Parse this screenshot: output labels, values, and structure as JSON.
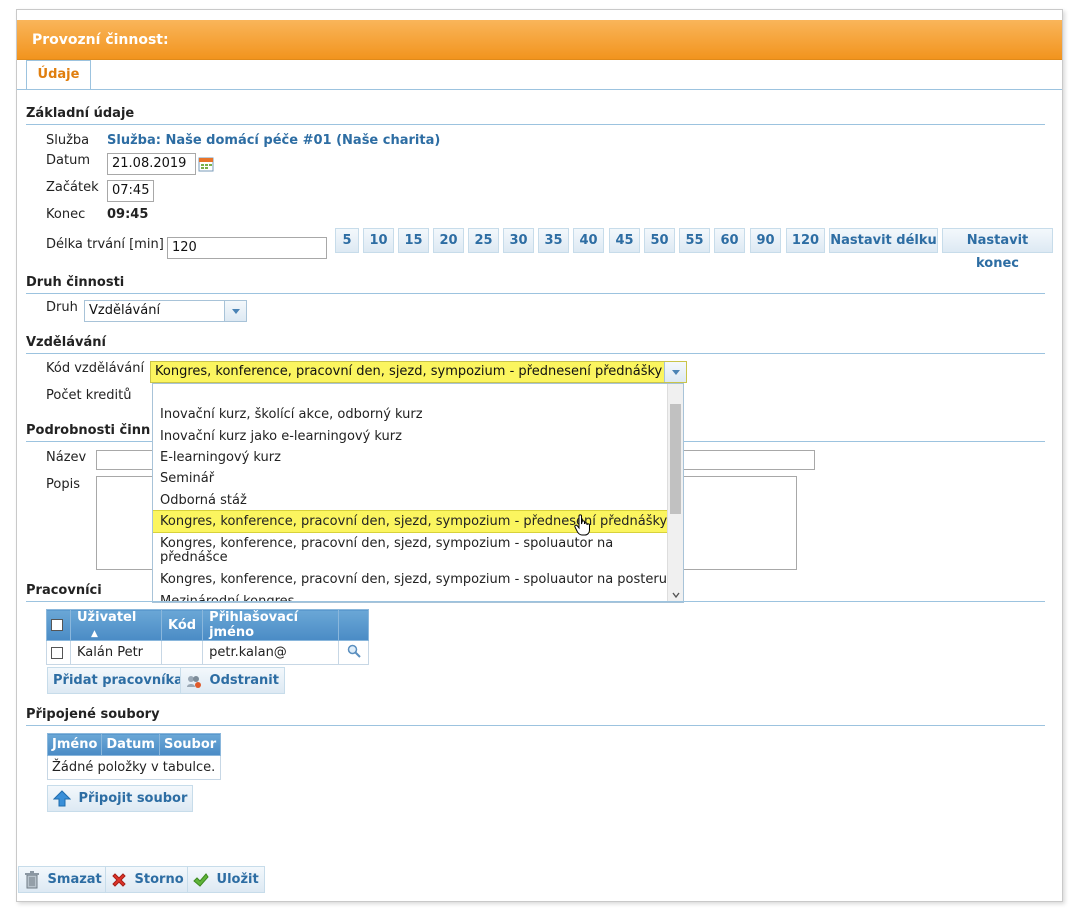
{
  "window": {
    "title": "Provozní činnost:"
  },
  "tabs": [
    {
      "label": "Údaje"
    }
  ],
  "basic": {
    "section_title": "Základní údaje",
    "service_label": "Služba",
    "service_value": "Služba: Naše domácí péče #01 (Naše charita)",
    "date_label": "Datum",
    "date_value": "21.08.2019",
    "start_label": "Začátek",
    "start_value": "07:45",
    "end_label": "Konec",
    "end_value": "09:45",
    "duration_label": "Délka trvání [min]",
    "duration_value": "120",
    "duration_buttons": [
      "5",
      "10",
      "15",
      "20",
      "25",
      "30",
      "35",
      "40",
      "45",
      "50",
      "55",
      "60",
      "90",
      "120"
    ],
    "set_duration_label": "Nastavit délku",
    "set_end_label": "Nastavit konec"
  },
  "activity": {
    "section_title": "Druh činnosti",
    "kind_label": "Druh",
    "kind_value": "Vzdělávání"
  },
  "education": {
    "section_title": "Vzdělávání",
    "code_label": "Kód vzdělávání",
    "code_value": "Kongres, konference, pracovní den, sjezd, sympozium - přednesení přednášky",
    "credits_label": "Počet kreditů",
    "options": [
      "Inovační kurz, školící akce, odborný kurz",
      "Inovační kurz jako e-learningový kurz",
      "E-learningový kurz",
      "Seminář",
      "Odborná stáž",
      "Kongres, konference, pracovní den, sjezd, sympozium - přednesení přednášky",
      "Kongres, konference, pracovní den, sjezd, sympozium - spoluautor na přednášce",
      "Kongres, konference, pracovní den, sjezd, sympozium - spoluautor na posteru",
      "Mezinárodní kongres"
    ],
    "selected_index": 5
  },
  "details": {
    "section_title": "Podrobnosti činn",
    "name_label": "Název",
    "name_value": "",
    "desc_label": "Popis",
    "desc_value": ""
  },
  "workers": {
    "section_title": "Pracovníci",
    "columns": [
      "Uživatel",
      "Kód",
      "Přihlašovací jméno"
    ],
    "sort_indicator": "▲",
    "rows": [
      {
        "user": "Kalán Petr",
        "code": "",
        "login": "petr.kalan@"
      }
    ],
    "add_label": "Přidat pracovníka",
    "remove_label": "Odstranit"
  },
  "files": {
    "section_title": "Připojené soubory",
    "columns": [
      "Jméno",
      "Datum",
      "Soubor"
    ],
    "empty_text": "Žádné položky v tabulce.",
    "attach_label": "Připojit soubor"
  },
  "footer": {
    "delete_label": "Smazat",
    "cancel_label": "Storno",
    "save_label": "Uložit"
  },
  "colors": {
    "accent_orange": "#f2941e",
    "link_blue": "#2d6da3",
    "header_blue": "#4a8bc5",
    "highlight_yellow": "#fbf55f"
  }
}
